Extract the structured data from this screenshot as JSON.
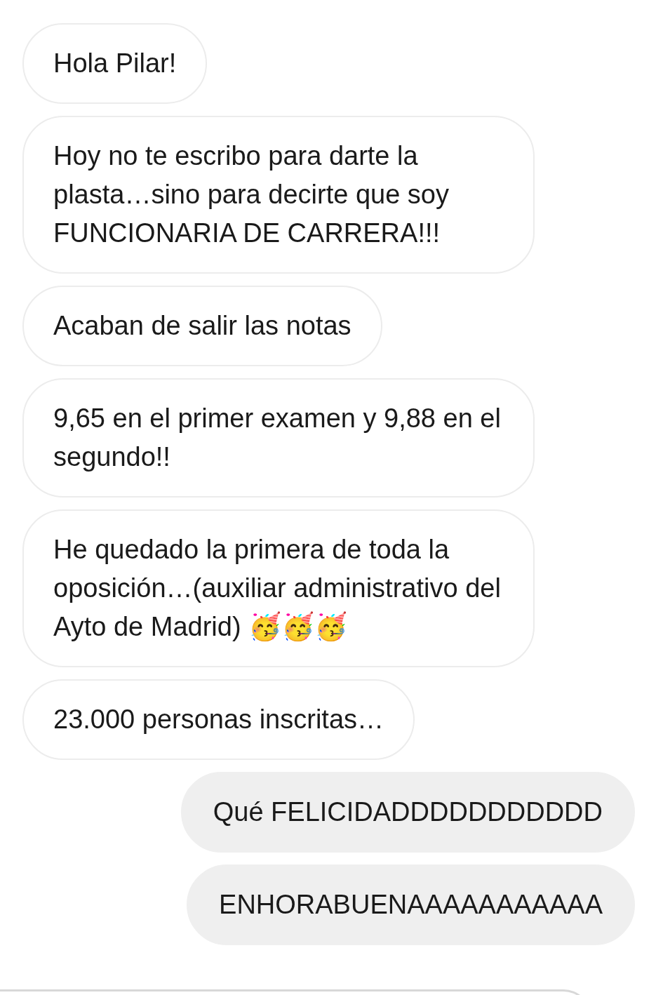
{
  "messages": [
    {
      "kind": "received",
      "text": "Hola Pilar!"
    },
    {
      "kind": "received",
      "text": "Hoy no te escribo para darte la plasta…sino para decirte que soy FUNCIONARIA DE CARRERA!!!"
    },
    {
      "kind": "received",
      "text": "Acaban de salir las notas"
    },
    {
      "kind": "received",
      "text": "9,65 en el primer examen y 9,88 en el segundo!!"
    },
    {
      "kind": "received",
      "text": "He quedado la primera de toda la oposición…(auxiliar administrativo del Ayto de Madrid) 🥳🥳🥳"
    },
    {
      "kind": "received",
      "text": "23.000 personas inscritas…"
    },
    {
      "kind": "sent",
      "text": "Qué FELICIDADDDDDDDDDDD"
    },
    {
      "kind": "sent",
      "text": "ENHORABUENAAAAAAAAAAA"
    }
  ]
}
